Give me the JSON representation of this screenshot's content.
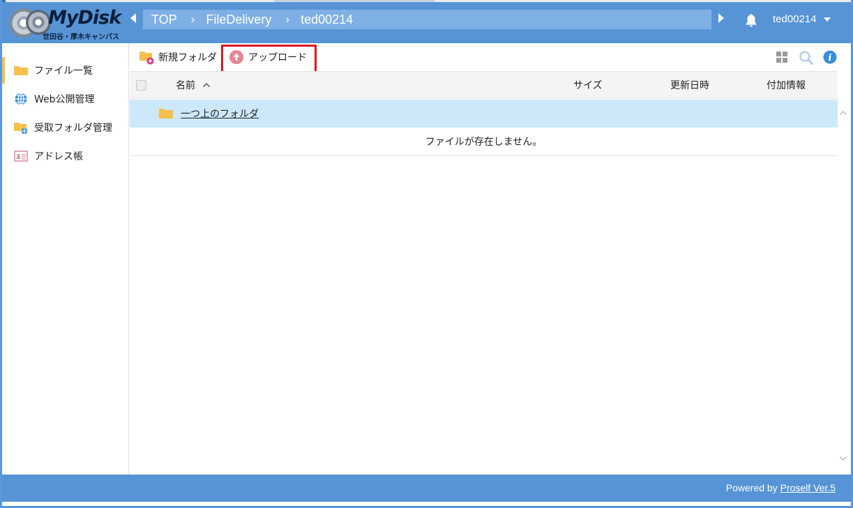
{
  "logo": {
    "brand": "MyDisk",
    "subtitle": "世田谷・厚木キャンパス"
  },
  "breadcrumb": {
    "items": [
      "TOP",
      "FileDelivery",
      "ted00214"
    ]
  },
  "header": {
    "username": "ted00214"
  },
  "sidebar": {
    "items": [
      {
        "label": "ファイル一覧",
        "icon": "folder-icon"
      },
      {
        "label": "Web公開管理",
        "icon": "globe-icon"
      },
      {
        "label": "受取フォルダ管理",
        "icon": "folder-globe-icon"
      },
      {
        "label": "アドレス帳",
        "icon": "address-card-icon"
      }
    ]
  },
  "toolbar": {
    "new_folder_label": "新規フォルダ",
    "upload_label": "アップロード"
  },
  "table": {
    "columns": {
      "name": "名前",
      "size": "サイズ",
      "modified": "更新日時",
      "info": "付加情報"
    },
    "parent_folder_label": "一つ上のフォルダ",
    "empty_message": "ファイルが存在しません。"
  },
  "footer": {
    "powered_by": "Powered by ",
    "product_link": "Proself Ver.5"
  },
  "colors": {
    "header": "#5694d6",
    "breadcrumb": "#7eb0e6",
    "selected_row": "#cce8f9",
    "highlight": "#e0141e",
    "folder": "#f5c14b"
  }
}
